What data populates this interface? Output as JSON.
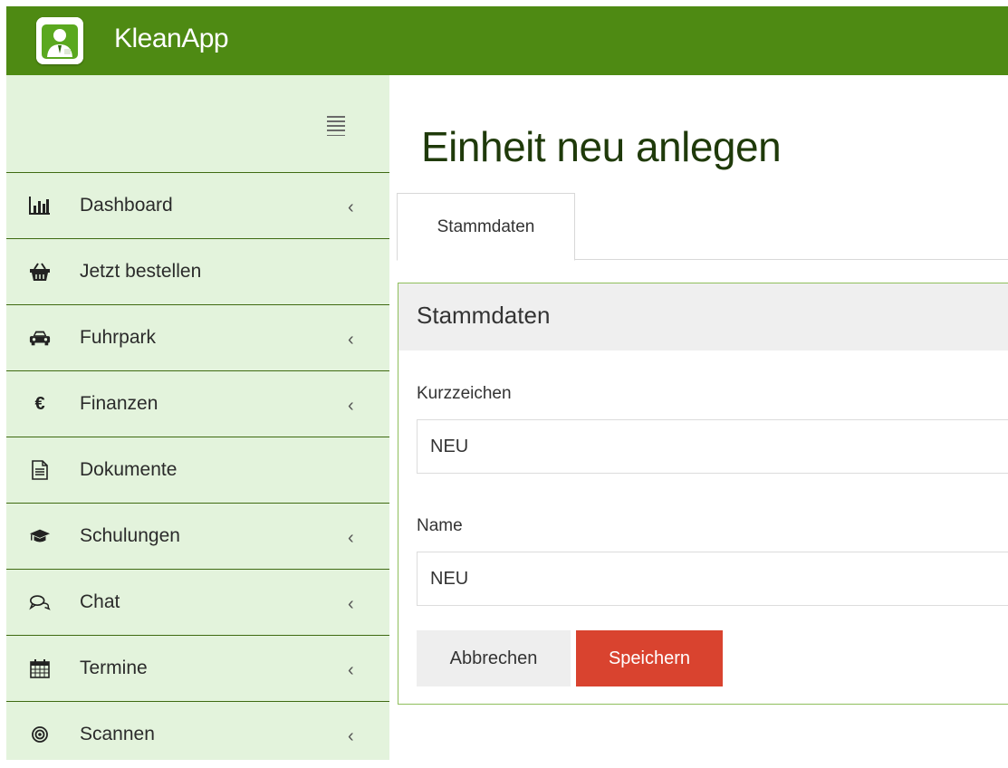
{
  "app": {
    "title": "KleanApp"
  },
  "sidebar": {
    "items": [
      {
        "label": "Dashboard",
        "icon": "bar-chart-icon",
        "has_submenu": true
      },
      {
        "label": "Jetzt bestellen",
        "icon": "basket-icon",
        "has_submenu": false
      },
      {
        "label": "Fuhrpark",
        "icon": "car-icon",
        "has_submenu": true
      },
      {
        "label": "Finanzen",
        "icon": "euro-icon",
        "has_submenu": true
      },
      {
        "label": "Dokumente",
        "icon": "document-icon",
        "has_submenu": false
      },
      {
        "label": "Schulungen",
        "icon": "graduation-cap-icon",
        "has_submenu": true
      },
      {
        "label": "Chat",
        "icon": "chat-icon",
        "has_submenu": true
      },
      {
        "label": "Termine",
        "icon": "calendar-icon",
        "has_submenu": true
      },
      {
        "label": "Scannen",
        "icon": "target-icon",
        "has_submenu": true
      }
    ],
    "euro_glyph": "€",
    "chevron_glyph": "‹"
  },
  "page": {
    "title": "Einheit neu anlegen",
    "tabs": [
      {
        "label": "Stammdaten",
        "active": true
      }
    ]
  },
  "panel": {
    "title": "Stammdaten",
    "fields": {
      "kurzzeichen": {
        "label": "Kurzzeichen",
        "value": "NEU"
      },
      "name": {
        "label": "Name",
        "value": "NEU"
      }
    },
    "buttons": {
      "cancel": "Abbrechen",
      "save": "Speichern"
    }
  },
  "colors": {
    "topbar": "#4e8a13",
    "sidebar_bg": "#e3f3dc",
    "sidebar_divider": "#3f6a12",
    "panel_border": "#8fbf5c",
    "save_button": "#d9432f",
    "title_text": "#1f3a0a"
  }
}
